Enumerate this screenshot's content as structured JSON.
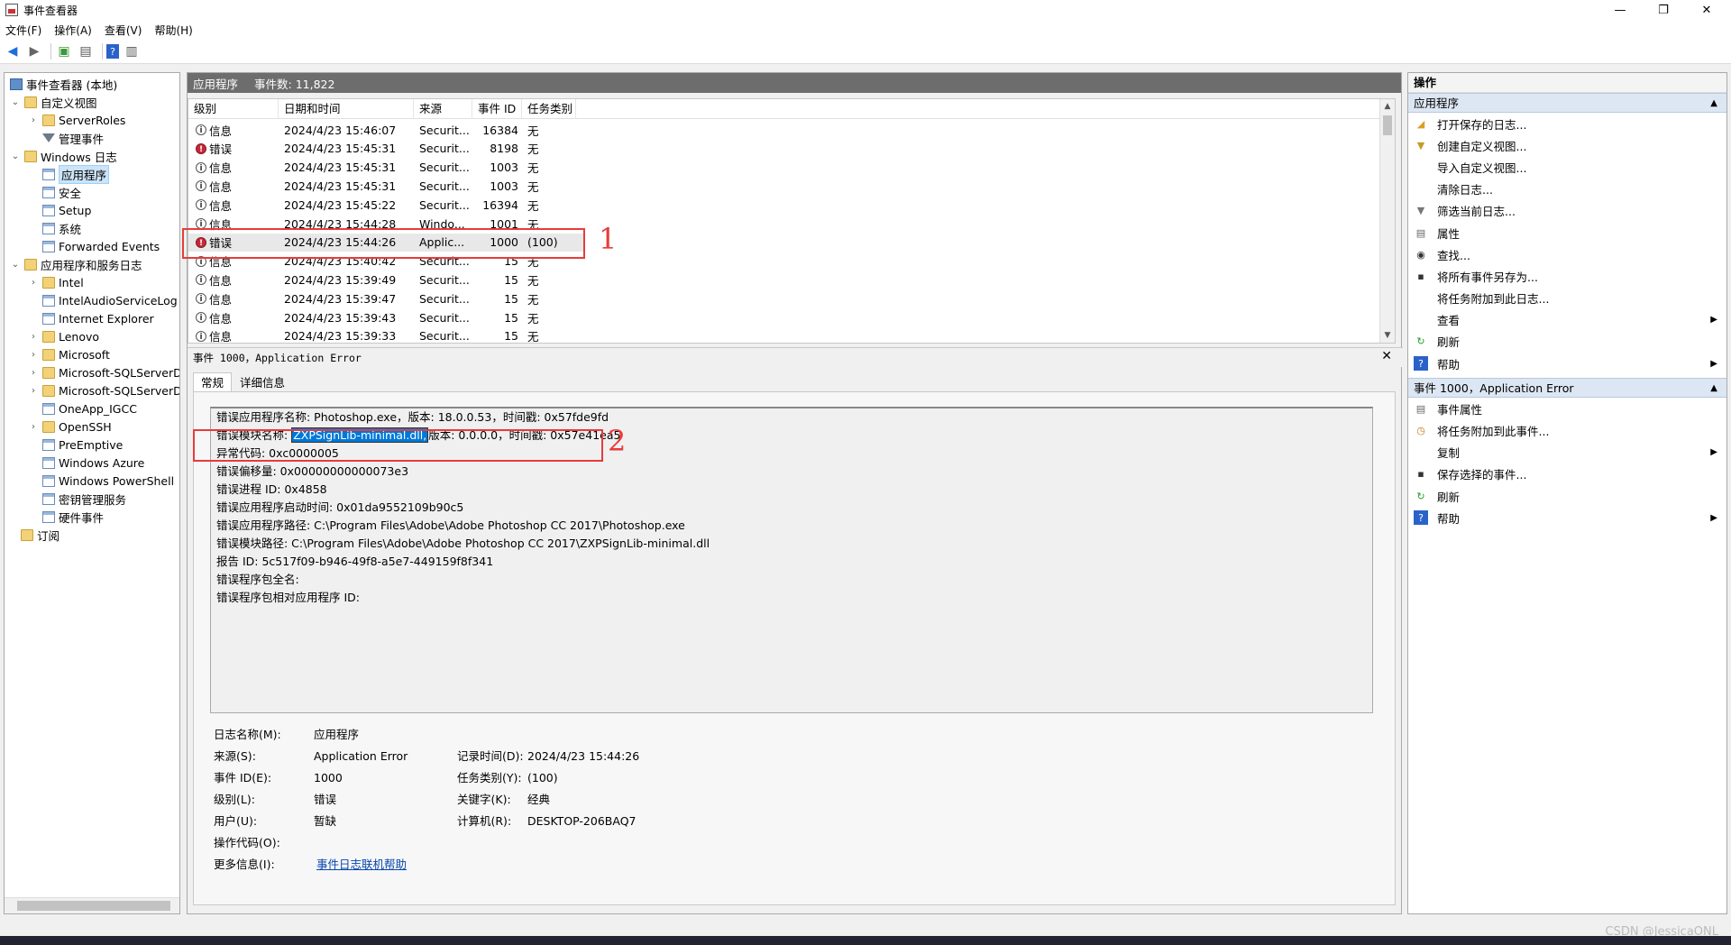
{
  "window": {
    "title": "事件查看器",
    "minimize": "—",
    "maximize": "❐",
    "close": "✕"
  },
  "menu": [
    "文件(F)",
    "操作(A)",
    "查看(V)",
    "帮助(H)"
  ],
  "tree": {
    "root": "事件查看器 (本地)",
    "custom_views": "自定义视图",
    "server_roles": "ServerRoles",
    "admin_events": "管理事件",
    "windows_logs": "Windows 日志",
    "application": "应用程序",
    "security": "安全",
    "setup": "Setup",
    "system": "系统",
    "forwarded": "Forwarded Events",
    "app_service_logs": "应用程序和服务日志",
    "sub": [
      "Intel",
      "IntelAudioServiceLog",
      "Internet Explorer",
      "Lenovo",
      "Microsoft",
      "Microsoft-SQLServerD",
      "Microsoft-SQLServerD",
      "OneApp_IGCC",
      "OpenSSH",
      "PreEmptive",
      "Windows Azure",
      "Windows PowerShell",
      "密钥管理服务",
      "硬件事件"
    ],
    "subscriptions": "订阅"
  },
  "center": {
    "log_name": "应用程序",
    "event_count": "事件数: 11,822"
  },
  "grid": {
    "headers": [
      "级别",
      "日期和时间",
      "来源",
      "事件 ID",
      "任务类别"
    ],
    "rows": [
      {
        "level": "信息",
        "type": "info",
        "time": "2024/4/23 15:46:07",
        "source": "Securit...",
        "id": "16384",
        "cat": "无"
      },
      {
        "level": "错误",
        "type": "err",
        "time": "2024/4/23 15:45:31",
        "source": "Securit...",
        "id": "8198",
        "cat": "无"
      },
      {
        "level": "信息",
        "type": "info",
        "time": "2024/4/23 15:45:31",
        "source": "Securit...",
        "id": "1003",
        "cat": "无"
      },
      {
        "level": "信息",
        "type": "info",
        "time": "2024/4/23 15:45:31",
        "source": "Securit...",
        "id": "1003",
        "cat": "无"
      },
      {
        "level": "信息",
        "type": "info",
        "time": "2024/4/23 15:45:22",
        "source": "Securit...",
        "id": "16394",
        "cat": "无"
      },
      {
        "level": "信息",
        "type": "info",
        "time": "2024/4/23 15:44:28",
        "source": "Windo...",
        "id": "1001",
        "cat": "无"
      },
      {
        "level": "错误",
        "type": "err",
        "time": "2024/4/23 15:44:26",
        "source": "Applic...",
        "id": "1000",
        "cat": "(100)"
      },
      {
        "level": "信息",
        "type": "info",
        "time": "2024/4/23 15:40:42",
        "source": "Securit...",
        "id": "15",
        "cat": "无"
      },
      {
        "level": "信息",
        "type": "info",
        "time": "2024/4/23 15:39:49",
        "source": "Securit...",
        "id": "15",
        "cat": "无"
      },
      {
        "level": "信息",
        "type": "info",
        "time": "2024/4/23 15:39:47",
        "source": "Securit...",
        "id": "15",
        "cat": "无"
      },
      {
        "level": "信息",
        "type": "info",
        "time": "2024/4/23 15:39:43",
        "source": "Securit...",
        "id": "15",
        "cat": "无"
      },
      {
        "level": "信息",
        "type": "info",
        "time": "2024/4/23 15:39:33",
        "source": "Securit...",
        "id": "15",
        "cat": "无"
      }
    ]
  },
  "detail": {
    "header": "事件 1000，Application Error",
    "close": "✕",
    "tabs": [
      "常规",
      "详细信息"
    ],
    "lines": [
      "错误应用程序名称: Photoshop.exe，版本: 18.0.0.53，时间戳: 0x57fde9fd",
      "错误模块名称: ",
      "异常代码: 0xc0000005",
      "错误偏移量: 0x00000000000073e3",
      "错误进程 ID: 0x4858",
      "错误应用程序启动时间: 0x01da9552109b90c5",
      "错误应用程序路径: C:\\Program Files\\Adobe\\Adobe Photoshop CC 2017\\Photoshop.exe",
      "错误模块路径: C:\\Program Files\\Adobe\\Adobe Photoshop CC 2017\\ZXPSignLib-minimal.dll",
      "报告 ID: 5c517f09-b946-49f8-a5e7-449159f8f341",
      "错误程序包全名:",
      "错误程序包相对应用程序 ID:"
    ],
    "module_selected": "ZXPSignLib-minimal.dll,",
    "module_rest": "版本: 0.0.0.0，时间戳: 0x57e41ea5",
    "props": {
      "log_name_label": "日志名称(M):",
      "log_name": "应用程序",
      "source_label": "来源(S):",
      "source": "Application Error",
      "logged_label": "记录时间(D):",
      "logged": "2024/4/23 15:44:26",
      "event_id_label": "事件 ID(E):",
      "event_id": "1000",
      "task_label": "任务类别(Y):",
      "task": "(100)",
      "level_label": "级别(L):",
      "level": "错误",
      "keywords_label": "关键字(K):",
      "keywords": "经典",
      "user_label": "用户(U):",
      "user": "暂缺",
      "computer_label": "计算机(R):",
      "computer": "DESKTOP-206BAQ7",
      "opcode_label": "操作代码(O):",
      "more_label": "更多信息(I):",
      "more_link": "事件日志联机帮助"
    }
  },
  "actions": {
    "title": "操作",
    "sec1": "应用程序",
    "items1": [
      "打开保存的日志...",
      "创建自定义视图...",
      "导入自定义视图...",
      "清除日志...",
      "筛选当前日志...",
      "属性",
      "查找...",
      "将所有事件另存为...",
      "将任务附加到此日志...",
      "查看",
      "刷新",
      "帮助"
    ],
    "sec2": "事件 1000，Application Error",
    "items2": [
      "事件属性",
      "将任务附加到此事件...",
      "复制",
      "保存选择的事件...",
      "刷新",
      "帮助"
    ]
  },
  "annotations": {
    "one": "1",
    "two": "2"
  },
  "watermark": "CSDN @JessicaONL"
}
